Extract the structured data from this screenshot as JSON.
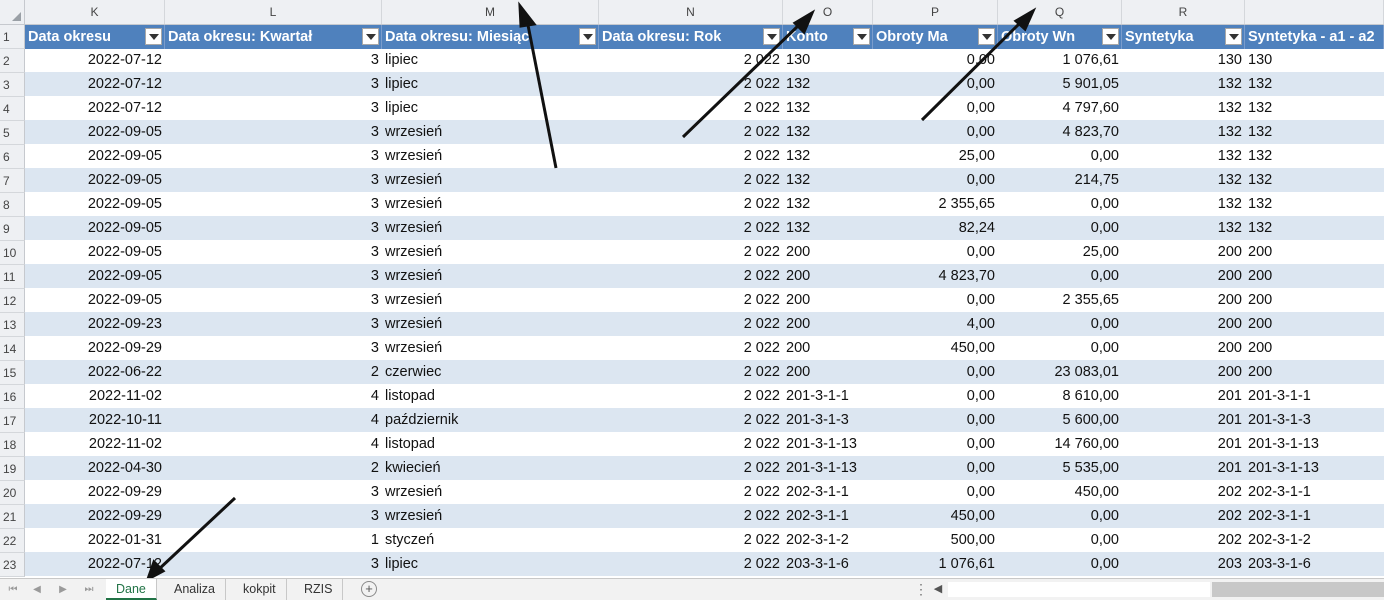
{
  "columns": [
    "K",
    "L",
    "M",
    "N",
    "O",
    "P",
    "Q",
    "R",
    ""
  ],
  "header_row_number": "1",
  "headers": [
    "Data okresu",
    "Data okresu: Kwartał",
    "Data okresu: Miesiąc",
    "Data okresu: Rok",
    "Konto",
    "Obroty Ma",
    "Obroty Wn",
    "Syntetyka",
    "Syntetyka - a1 - a2"
  ],
  "rows": [
    {
      "n": "2",
      "date": "2022-07-12",
      "q": "3",
      "month": "lipiec",
      "year": "2 022",
      "konto": "130",
      "ma": "0,00",
      "wn": "1 076,61",
      "syn": "130",
      "syn2": "130"
    },
    {
      "n": "3",
      "date": "2022-07-12",
      "q": "3",
      "month": "lipiec",
      "year": "2 022",
      "konto": "132",
      "ma": "0,00",
      "wn": "5 901,05",
      "syn": "132",
      "syn2": "132"
    },
    {
      "n": "4",
      "date": "2022-07-12",
      "q": "3",
      "month": "lipiec",
      "year": "2 022",
      "konto": "132",
      "ma": "0,00",
      "wn": "4 797,60",
      "syn": "132",
      "syn2": "132"
    },
    {
      "n": "5",
      "date": "2022-09-05",
      "q": "3",
      "month": "wrzesień",
      "year": "2 022",
      "konto": "132",
      "ma": "0,00",
      "wn": "4 823,70",
      "syn": "132",
      "syn2": "132"
    },
    {
      "n": "6",
      "date": "2022-09-05",
      "q": "3",
      "month": "wrzesień",
      "year": "2 022",
      "konto": "132",
      "ma": "25,00",
      "wn": "0,00",
      "syn": "132",
      "syn2": "132"
    },
    {
      "n": "7",
      "date": "2022-09-05",
      "q": "3",
      "month": "wrzesień",
      "year": "2 022",
      "konto": "132",
      "ma": "0,00",
      "wn": "214,75",
      "syn": "132",
      "syn2": "132"
    },
    {
      "n": "8",
      "date": "2022-09-05",
      "q": "3",
      "month": "wrzesień",
      "year": "2 022",
      "konto": "132",
      "ma": "2 355,65",
      "wn": "0,00",
      "syn": "132",
      "syn2": "132"
    },
    {
      "n": "9",
      "date": "2022-09-05",
      "q": "3",
      "month": "wrzesień",
      "year": "2 022",
      "konto": "132",
      "ma": "82,24",
      "wn": "0,00",
      "syn": "132",
      "syn2": "132"
    },
    {
      "n": "10",
      "date": "2022-09-05",
      "q": "3",
      "month": "wrzesień",
      "year": "2 022",
      "konto": "200",
      "ma": "0,00",
      "wn": "25,00",
      "syn": "200",
      "syn2": "200"
    },
    {
      "n": "11",
      "date": "2022-09-05",
      "q": "3",
      "month": "wrzesień",
      "year": "2 022",
      "konto": "200",
      "ma": "4 823,70",
      "wn": "0,00",
      "syn": "200",
      "syn2": "200"
    },
    {
      "n": "12",
      "date": "2022-09-05",
      "q": "3",
      "month": "wrzesień",
      "year": "2 022",
      "konto": "200",
      "ma": "0,00",
      "wn": "2 355,65",
      "syn": "200",
      "syn2": "200"
    },
    {
      "n": "13",
      "date": "2022-09-23",
      "q": "3",
      "month": "wrzesień",
      "year": "2 022",
      "konto": "200",
      "ma": "4,00",
      "wn": "0,00",
      "syn": "200",
      "syn2": "200"
    },
    {
      "n": "14",
      "date": "2022-09-29",
      "q": "3",
      "month": "wrzesień",
      "year": "2 022",
      "konto": "200",
      "ma": "450,00",
      "wn": "0,00",
      "syn": "200",
      "syn2": "200"
    },
    {
      "n": "15",
      "date": "2022-06-22",
      "q": "2",
      "month": "czerwiec",
      "year": "2 022",
      "konto": "200",
      "ma": "0,00",
      "wn": "23 083,01",
      "syn": "200",
      "syn2": "200"
    },
    {
      "n": "16",
      "date": "2022-11-02",
      "q": "4",
      "month": "listopad",
      "year": "2 022",
      "konto": "201-3-1-1",
      "ma": "0,00",
      "wn": "8 610,00",
      "syn": "201",
      "syn2": "201-3-1-1"
    },
    {
      "n": "17",
      "date": "2022-10-11",
      "q": "4",
      "month": "październik",
      "year": "2 022",
      "konto": "201-3-1-3",
      "ma": "0,00",
      "wn": "5 600,00",
      "syn": "201",
      "syn2": "201-3-1-3"
    },
    {
      "n": "18",
      "date": "2022-11-02",
      "q": "4",
      "month": "listopad",
      "year": "2 022",
      "konto": "201-3-1-13",
      "ma": "0,00",
      "wn": "14 760,00",
      "syn": "201",
      "syn2": "201-3-1-13"
    },
    {
      "n": "19",
      "date": "2022-04-30",
      "q": "2",
      "month": "kwiecień",
      "year": "2 022",
      "konto": "201-3-1-13",
      "ma": "0,00",
      "wn": "5 535,00",
      "syn": "201",
      "syn2": "201-3-1-13"
    },
    {
      "n": "20",
      "date": "2022-09-29",
      "q": "3",
      "month": "wrzesień",
      "year": "2 022",
      "konto": "202-3-1-1",
      "ma": "0,00",
      "wn": "450,00",
      "syn": "202",
      "syn2": "202-3-1-1"
    },
    {
      "n": "21",
      "date": "2022-09-29",
      "q": "3",
      "month": "wrzesień",
      "year": "2 022",
      "konto": "202-3-1-1",
      "ma": "450,00",
      "wn": "0,00",
      "syn": "202",
      "syn2": "202-3-1-1"
    },
    {
      "n": "22",
      "date": "2022-01-31",
      "q": "1",
      "month": "styczeń",
      "year": "2 022",
      "konto": "202-3-1-2",
      "ma": "500,00",
      "wn": "0,00",
      "syn": "202",
      "syn2": "202-3-1-2"
    },
    {
      "n": "23",
      "date": "2022-07-12",
      "q": "3",
      "month": "lipiec",
      "year": "2 022",
      "konto": "203-3-1-6",
      "ma": "1 076,61",
      "wn": "0,00",
      "syn": "203",
      "syn2": "203-3-1-6"
    }
  ],
  "sheet_tabs": [
    {
      "label": "Dane",
      "active": true
    },
    {
      "label": "Analiza",
      "active": false
    },
    {
      "label": "kokpit",
      "active": false
    },
    {
      "label": "RZIS",
      "active": false
    }
  ],
  "tab_nav": {
    "first": "⏮",
    "prev": "◀",
    "next": "▶",
    "last": "⏭",
    "add": "+",
    "dots": "⋮",
    "scroll_left": "◀"
  },
  "colors": {
    "header_blue": "#4f81bd",
    "band": "#dce6f1",
    "active_tab": "#217346"
  }
}
